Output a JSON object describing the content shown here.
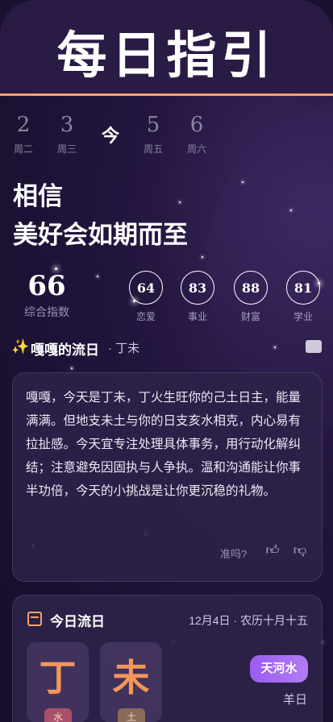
{
  "header": {
    "title": "每日指引"
  },
  "days": [
    {
      "num": "2",
      "weekday": "周二"
    },
    {
      "num": "3",
      "weekday": "周三"
    },
    {
      "num": "今",
      "weekday": ""
    },
    {
      "num": "5",
      "weekday": "周五"
    },
    {
      "num": "6",
      "weekday": "周六"
    }
  ],
  "slogan": {
    "line1": "相信",
    "line2": "美好会如期而至"
  },
  "scores": {
    "total": {
      "value": "66",
      "label": "综合指数"
    },
    "metrics": [
      {
        "value": "64",
        "label": "恋爱"
      },
      {
        "value": "83",
        "label": "事业"
      },
      {
        "value": "88",
        "label": "财富"
      },
      {
        "value": "81",
        "label": "学业"
      }
    ]
  },
  "flow": {
    "icon": "sparkle-icon",
    "title": "嘎嘎的流日",
    "subtitle": "· 丁未",
    "text": "嘎嘎，今天是丁未，丁火生旺你的己土日主，能量满满。但地支未土与你的日支亥水相克，内心易有拉扯感。今天宜专注处理具体事务，用行动化解纠结；注意避免因固执与人争执。温和沟通能让你事半功倍，今天的小挑战是让你更沉稳的礼物。",
    "feedback_label": "准吗?"
  },
  "today": {
    "title": "今日流日",
    "date": "12月4日 · 农历十月十五",
    "stem": {
      "char": "丁",
      "tag": "水"
    },
    "branch": {
      "char": "未",
      "tag": "土"
    },
    "badge": "天河水",
    "zodiac": "羊日"
  },
  "colors": {
    "accent": "#f0a36a",
    "pill": "#a86cf2",
    "background": "#1b1133"
  }
}
